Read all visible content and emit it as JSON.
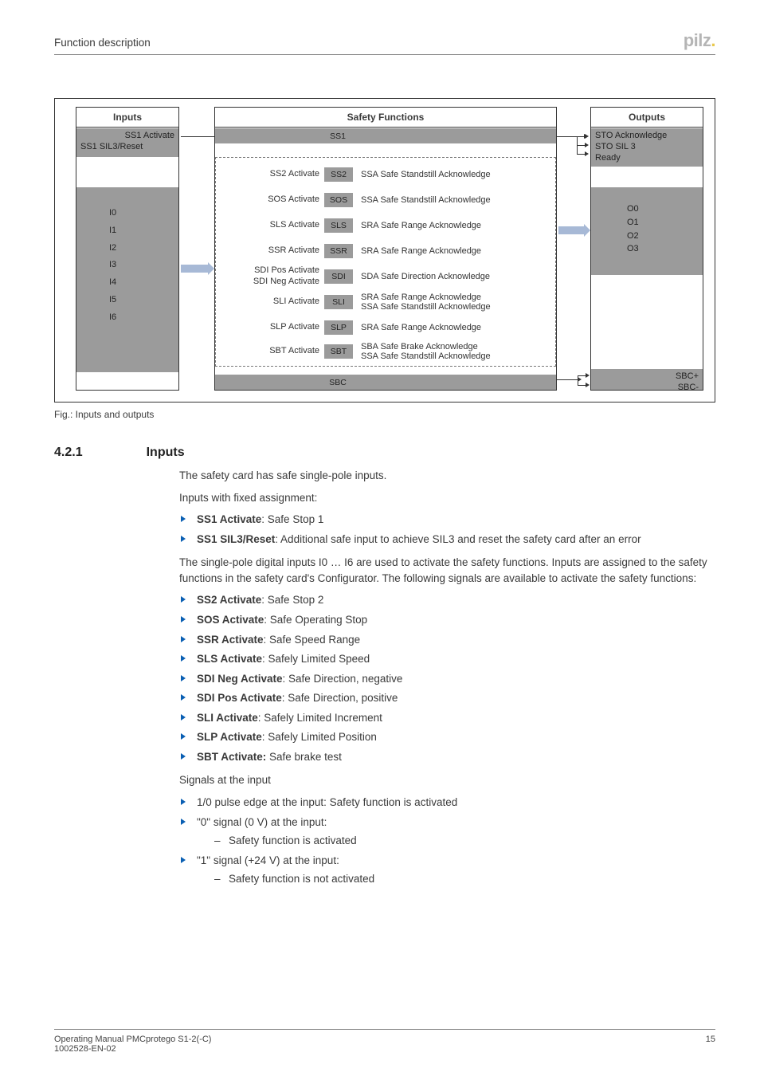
{
  "header": {
    "title": "Function description",
    "logo": "pilz"
  },
  "page": {
    "foot1": "Operating Manual PMCprotego S1-2(-C)",
    "foot2": "1002528-EN-02",
    "num": "15"
  },
  "diag": {
    "inputs_head": "Inputs",
    "sf_head": "Safety Functions",
    "out_head": "Outputs",
    "in_top1": "SS1 Activate",
    "in_top2": "SS1 SIL3/Reset",
    "in_list": [
      "I0",
      "I1",
      "I2",
      "I3",
      "I4",
      "I5",
      "I6"
    ],
    "sf_top_tag": "SS1",
    "sf_rows": [
      {
        "l": "SS2 Activate",
        "t": "SS2",
        "r": "SSA Safe Standstill Acknowledge"
      },
      {
        "l": "SOS Activate",
        "t": "SOS",
        "r": "SSA Safe Standstill Acknowledge"
      },
      {
        "l": "SLS Activate",
        "t": "SLS",
        "r": "SRA Safe Range Acknowledge"
      },
      {
        "l": "SSR Activate",
        "t": "SSR",
        "r": "SRA Safe Range Acknowledge"
      },
      {
        "l": "SDI Pos Activate\nSDI Neg Activate",
        "t": "SDI",
        "r": "SDA Safe Direction Acknowledge"
      },
      {
        "l": "SLI Activate",
        "t": "SLI",
        "r": "SRA Safe Range Acknowledge\nSSA Safe Standstill Acknowledge"
      },
      {
        "l": "SLP Activate",
        "t": "SLP",
        "r": "SRA Safe Range Acknowledge"
      },
      {
        "l": "SBT Activate",
        "t": "SBT",
        "r": "SBA Safe Brake Acknowledge\nSSA Safe Standstill Acknowledge"
      }
    ],
    "sf_bot_tag": "SBC",
    "out_top1": "STO Acknowledge",
    "out_top2": "STO SIL 3",
    "out_top3": "Ready",
    "out_list": [
      "O0",
      "O1",
      "O2",
      "O3"
    ],
    "out_bot1": "SBC+",
    "out_bot2": "SBC-",
    "caption": "Fig.: Inputs and outputs"
  },
  "section": {
    "num": "4.2.1",
    "title": "Inputs",
    "p1": "The safety card has safe single-pole inputs.",
    "p2": "Inputs with fixed assignment:",
    "l1a_b": "SS1 Activate",
    "l1a_t": ": Safe Stop 1",
    "l1b_b": "SS1 SIL3/Reset",
    "l1b_t": ": Additional safe input to achieve SIL3 and reset the safety card after an error",
    "p3": "The single-pole digital inputs I0 … I6 are used to activate the safety functions. Inputs are assigned to the safety functions in the safety card's Configurator. The following signals are available to activate the safety functions:",
    "list2": [
      {
        "b": "SS2 Activate",
        "t": ": Safe Stop 2"
      },
      {
        "b": "SOS Activate",
        "t": ": Safe Operating Stop"
      },
      {
        "b": "SSR Activate",
        "t": ": Safe Speed Range"
      },
      {
        "b": "SLS Activate",
        "t": ": Safely Limited Speed"
      },
      {
        "b": "SDI Neg Activate",
        "t": ": Safe Direction, negative"
      },
      {
        "b": "SDI Pos Activate",
        "t": ": Safe Direction, positive"
      },
      {
        "b": "SLI Activate",
        "t": ": Safely Limited Increment"
      },
      {
        "b": "SLP Activate",
        "t": ": Safely Limited Position"
      },
      {
        "b": "SBT Activate:",
        "t": " Safe brake test"
      }
    ],
    "p4": "Signals at the input",
    "l3a": "1/0 pulse edge at the input: Safety function is activated",
    "l3b": "\"0\" signal (0 V) at the input:",
    "l3b_sub": "Safety function is activated",
    "l3c": "\"1\" signal (+24 V) at the input:",
    "l3c_sub": "Safety function is not activated"
  }
}
